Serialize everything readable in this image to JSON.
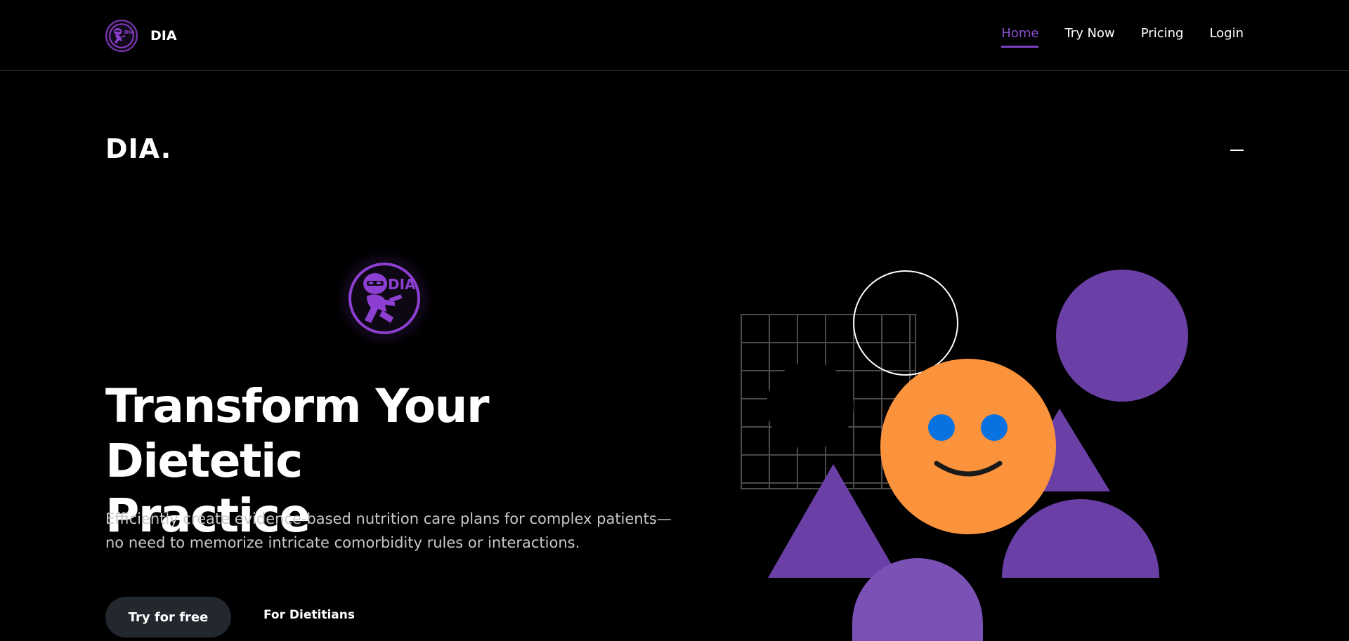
{
  "brand": {
    "name": "DIA",
    "logo_text": "DIA"
  },
  "nav": {
    "items": [
      {
        "label": "Home",
        "active": true
      },
      {
        "label": "Try Now",
        "active": false
      },
      {
        "label": "Pricing",
        "active": false
      },
      {
        "label": "Login",
        "active": false
      }
    ]
  },
  "subheader": {
    "title": "DIA.",
    "menu_icon": "minus-icon"
  },
  "hero": {
    "logo_icon": "ninja-logo-icon",
    "logo_text": "DIA",
    "title_line1": "Transform Your Dietetic",
    "title_line2": "Practice",
    "description": "Efficiently create evidence-based nutrition care plans for complex patients—no need to memorize intricate comorbidity rules or interactions.",
    "primary_button": "Try for free",
    "secondary_link": "For Dietitians"
  },
  "colors": {
    "accent": "#7b3fc4",
    "purple_shape": "#6a40a6",
    "orange_face": "#fb923c",
    "eye_blue": "#0872e0",
    "button_bg": "#23272e"
  }
}
